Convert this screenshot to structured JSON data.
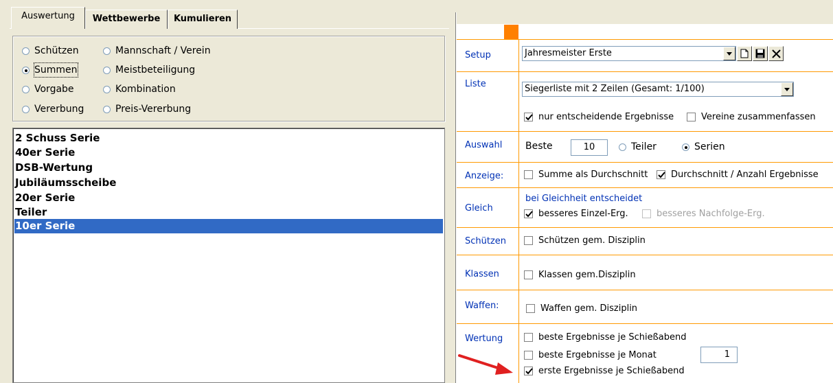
{
  "tabs": [
    {
      "label": "Auswertung",
      "active": true
    },
    {
      "label": "Wettbewerbe",
      "active": false
    },
    {
      "label": "Kumulieren",
      "active": false
    }
  ],
  "mode_radios": [
    {
      "label": "Schützen",
      "selected": false
    },
    {
      "label": "Mannschaft / Verein",
      "selected": false
    },
    {
      "label": "Summen",
      "selected": true
    },
    {
      "label": "Meistbeteiligung",
      "selected": false
    },
    {
      "label": "Vorgabe",
      "selected": false
    },
    {
      "label": "Kombination",
      "selected": false
    },
    {
      "label": "Vererbung",
      "selected": false
    },
    {
      "label": "Preis-Vererbung",
      "selected": false
    }
  ],
  "series_list": {
    "items": [
      "2 Schuss Serie",
      "40er Serie",
      "DSB-Wertung",
      "Jubiläumsscheibe",
      "20er Serie",
      "Teiler",
      "10er Serie"
    ],
    "selected_index": 6
  },
  "settings": {
    "setup": {
      "label": "Setup",
      "value": "Jahresmeister Erste"
    },
    "liste": {
      "label": "Liste",
      "value": "Siegerliste mit 2 Zeilen (Gesamt: 1/100)",
      "cb1": {
        "label": "nur entscheidende Ergebnisse",
        "checked": true
      },
      "cb2": {
        "label": "Vereine zusammenfassen",
        "checked": false
      }
    },
    "auswahl": {
      "label": "Auswahl",
      "beste_label": "Beste",
      "beste_value": "10",
      "radio_teiler": {
        "label": "Teiler",
        "selected": false
      },
      "radio_serien": {
        "label": "Serien",
        "selected": true
      }
    },
    "anzeige": {
      "label": "Anzeige:",
      "cb1": {
        "label": "Summe als Durchschnitt",
        "checked": false
      },
      "cb2": {
        "label": "Durchschnitt / Anzahl Ergebnisse",
        "checked": true
      }
    },
    "gleich": {
      "label": "Gleich",
      "note": "bei Gleichheit entscheidet",
      "cb1": {
        "label": "besseres Einzel-Erg.",
        "checked": true
      },
      "cb2": {
        "label": "besseres Nachfolge-Erg.",
        "checked": false,
        "disabled": true
      }
    },
    "schuetzen": {
      "label": "Schützen",
      "cb": {
        "label": "Schützen gem. Disziplin",
        "checked": false
      }
    },
    "klassen": {
      "label": "Klassen",
      "cb": {
        "label": "Klassen gem.Disziplin",
        "checked": false
      }
    },
    "waffen": {
      "label": "Waffen:",
      "cb": {
        "label": "Waffen gem. Disziplin",
        "checked": false
      }
    },
    "wertung": {
      "label": "Wertung",
      "cb1": {
        "label": "beste Ergebnisse je Schießabend",
        "checked": false
      },
      "cb2": {
        "label": "beste Ergebnisse je Monat",
        "checked": false
      },
      "monat_value": "1",
      "cb3": {
        "label": "erste Ergebnisse je Schießabend",
        "checked": true
      }
    }
  },
  "colors": {
    "accent_orange": "#ff8000",
    "label_blue": "#0031b5",
    "selection": "#316ac5",
    "arrow_red": "#e02020"
  }
}
